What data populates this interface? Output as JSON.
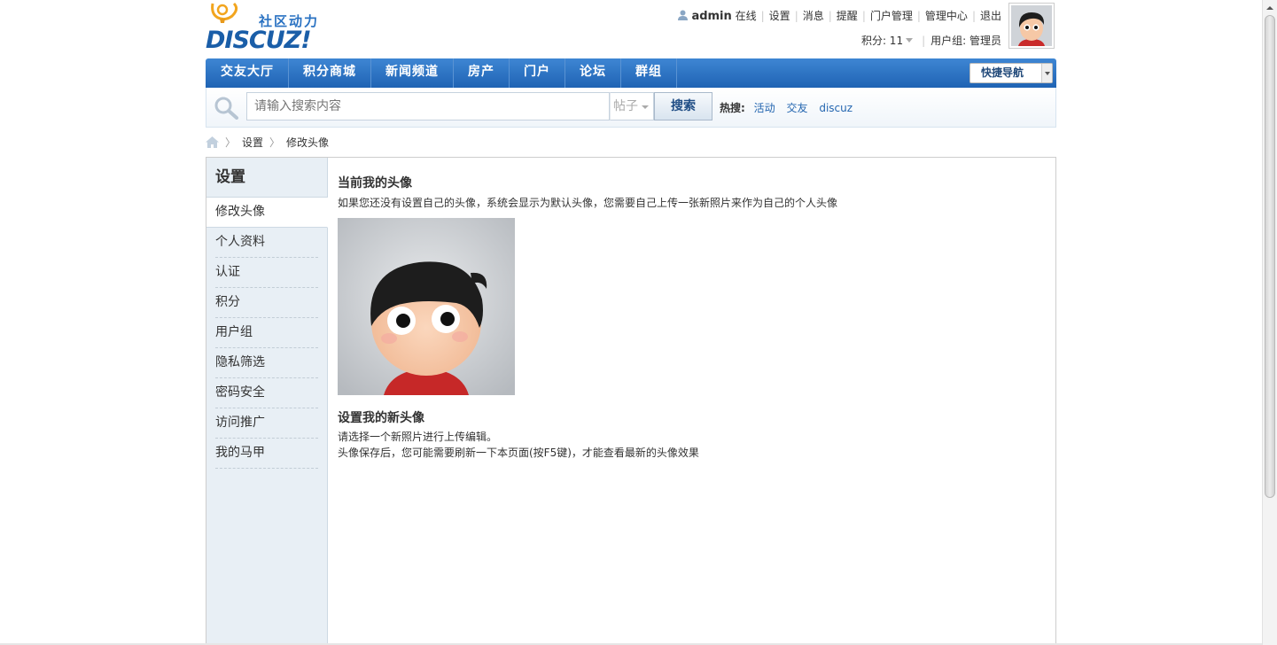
{
  "header": {
    "logo_slogan": "社区动力",
    "logo_word": "DISCUZ!",
    "user": {
      "name": "admin",
      "status": "在线",
      "links": [
        "设置",
        "消息",
        "提醒",
        "门户管理",
        "管理中心",
        "退出"
      ]
    },
    "credits_label": "积分: 11",
    "usergroup_label": "用户组: 管理员"
  },
  "nav": {
    "items": [
      "交友大厅",
      "积分商城",
      "新闻频道",
      "房产",
      "门户",
      "论坛",
      "群组"
    ],
    "quick_nav": "快捷导航"
  },
  "search": {
    "placeholder": "请输入搜索内容",
    "type": "帖子",
    "button": "搜索",
    "hot_label": "热搜:",
    "hot_items": [
      "活动",
      "交友",
      "discuz"
    ]
  },
  "breadcrumb": [
    "设置",
    "修改头像"
  ],
  "sidebar": {
    "title": "设置",
    "items": [
      "修改头像",
      "个人资料",
      "认证",
      "积分",
      "用户组",
      "隐私筛选",
      "密码安全",
      "访问推广",
      "我的马甲"
    ],
    "active_index": 0
  },
  "content": {
    "current_title": "当前我的头像",
    "current_desc": "如果您还没有设置自己的头像，系统会显示为默认头像，您需要自己上传一张新照片来作为自己的个人头像",
    "new_title": "设置我的新头像",
    "new_desc1": "请选择一个新照片进行上传编辑。",
    "new_desc2": "头像保存后，您可能需要刷新一下本页面(按F5键)，才能查看最新的头像效果"
  },
  "colors": {
    "nav_bg": "#2a6fc0",
    "link": "#2466b0",
    "sidebar_bg": "#e8eff5"
  }
}
